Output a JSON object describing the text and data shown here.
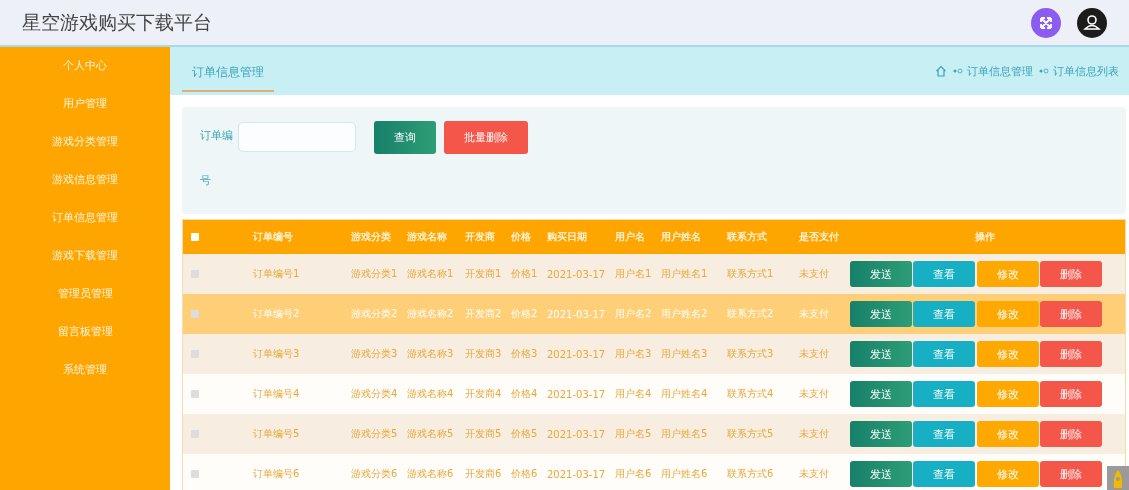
{
  "header": {
    "title": "星空游戏购买下载平台"
  },
  "sidebar": {
    "items": [
      {
        "label": "个人中心",
        "selected": false
      },
      {
        "label": "用户管理",
        "selected": false
      },
      {
        "label": "游戏分类管理",
        "selected": false
      },
      {
        "label": "游戏信息管理",
        "selected": false
      },
      {
        "label": "订单信息管理",
        "selected": false
      },
      {
        "label": "游戏下载管理",
        "selected": false
      },
      {
        "label": "管理员管理",
        "selected": false
      },
      {
        "label": "留言板管理",
        "selected": false
      },
      {
        "label": "系统管理",
        "selected": false
      }
    ]
  },
  "tabs": [
    {
      "label": "订单信息管理",
      "selected": true
    }
  ],
  "breadcrumb": [
    "订单信息管理",
    "订单信息列表"
  ],
  "search": {
    "label": "订单编号",
    "buttons": [
      {
        "label": "查询",
        "kind": "query"
      },
      {
        "label": "批量删除",
        "kind": "danger"
      }
    ]
  },
  "table": {
    "columns": [
      "订单编号",
      "游戏分类",
      "游戏名称",
      "开发商",
      "价格",
      "购买日期",
      "用户名",
      "用户姓名",
      "联系方式",
      "是否支付",
      "操作"
    ],
    "select_all_checked": false,
    "rows": [
      {
        "checked": false,
        "highlighted": false,
        "cells": [
          "订单编号1",
          "游戏分类1",
          "游戏名称1",
          "开发商1",
          "价格1",
          "2021-03-17",
          "用户名1",
          "用户姓名1",
          "联系方式1",
          "未支付"
        ],
        "actions": [
          {
            "label": "发送",
            "kind": "send"
          },
          {
            "label": "查看",
            "kind": "view"
          },
          {
            "label": "修改",
            "kind": "edit"
          },
          {
            "label": "删除",
            "kind": "delete"
          }
        ]
      },
      {
        "checked": false,
        "highlighted": true,
        "cells": [
          "订单编号2",
          "游戏分类2",
          "游戏名称2",
          "开发商2",
          "价格2",
          "2021-03-17",
          "用户名2",
          "用户姓名2",
          "联系方式2",
          "未支付"
        ],
        "actions": [
          {
            "label": "发送",
            "kind": "send"
          },
          {
            "label": "查看",
            "kind": "view"
          },
          {
            "label": "修改",
            "kind": "edit"
          },
          {
            "label": "删除",
            "kind": "delete"
          }
        ]
      },
      {
        "checked": false,
        "highlighted": false,
        "cells": [
          "订单编号3",
          "游戏分类3",
          "游戏名称3",
          "开发商3",
          "价格3",
          "2021-03-17",
          "用户名3",
          "用户姓名3",
          "联系方式3",
          "未支付"
        ],
        "actions": [
          {
            "label": "发送",
            "kind": "send"
          },
          {
            "label": "查看",
            "kind": "view"
          },
          {
            "label": "修改",
            "kind": "edit"
          },
          {
            "label": "删除",
            "kind": "delete"
          }
        ]
      },
      {
        "checked": false,
        "highlighted": false,
        "cells": [
          "订单编号4",
          "游戏分类4",
          "游戏名称4",
          "开发商4",
          "价格4",
          "2021-03-17",
          "用户名4",
          "用户姓名4",
          "联系方式4",
          "未支付"
        ],
        "actions": [
          {
            "label": "发送",
            "kind": "send"
          },
          {
            "label": "查看",
            "kind": "view"
          },
          {
            "label": "修改",
            "kind": "edit"
          },
          {
            "label": "删除",
            "kind": "delete"
          }
        ]
      },
      {
        "checked": false,
        "highlighted": false,
        "cells": [
          "订单编号5",
          "游戏分类5",
          "游戏名称5",
          "开发商5",
          "价格5",
          "2021-03-17",
          "用户名5",
          "用户姓名5",
          "联系方式5",
          "未支付"
        ],
        "actions": [
          {
            "label": "发送",
            "kind": "send"
          },
          {
            "label": "查看",
            "kind": "view"
          },
          {
            "label": "修改",
            "kind": "edit"
          },
          {
            "label": "删除",
            "kind": "delete"
          }
        ]
      },
      {
        "checked": false,
        "highlighted": false,
        "cells": [
          "订单编号6",
          "游戏分类6",
          "游戏名称6",
          "开发商6",
          "价格6",
          "2021-03-17",
          "用户名6",
          "用户姓名6",
          "联系方式6",
          "未支付"
        ],
        "actions": [
          {
            "label": "发送",
            "kind": "send"
          },
          {
            "label": "查看",
            "kind": "view"
          },
          {
            "label": "修改",
            "kind": "edit"
          },
          {
            "label": "删除",
            "kind": "delete"
          }
        ]
      }
    ]
  }
}
